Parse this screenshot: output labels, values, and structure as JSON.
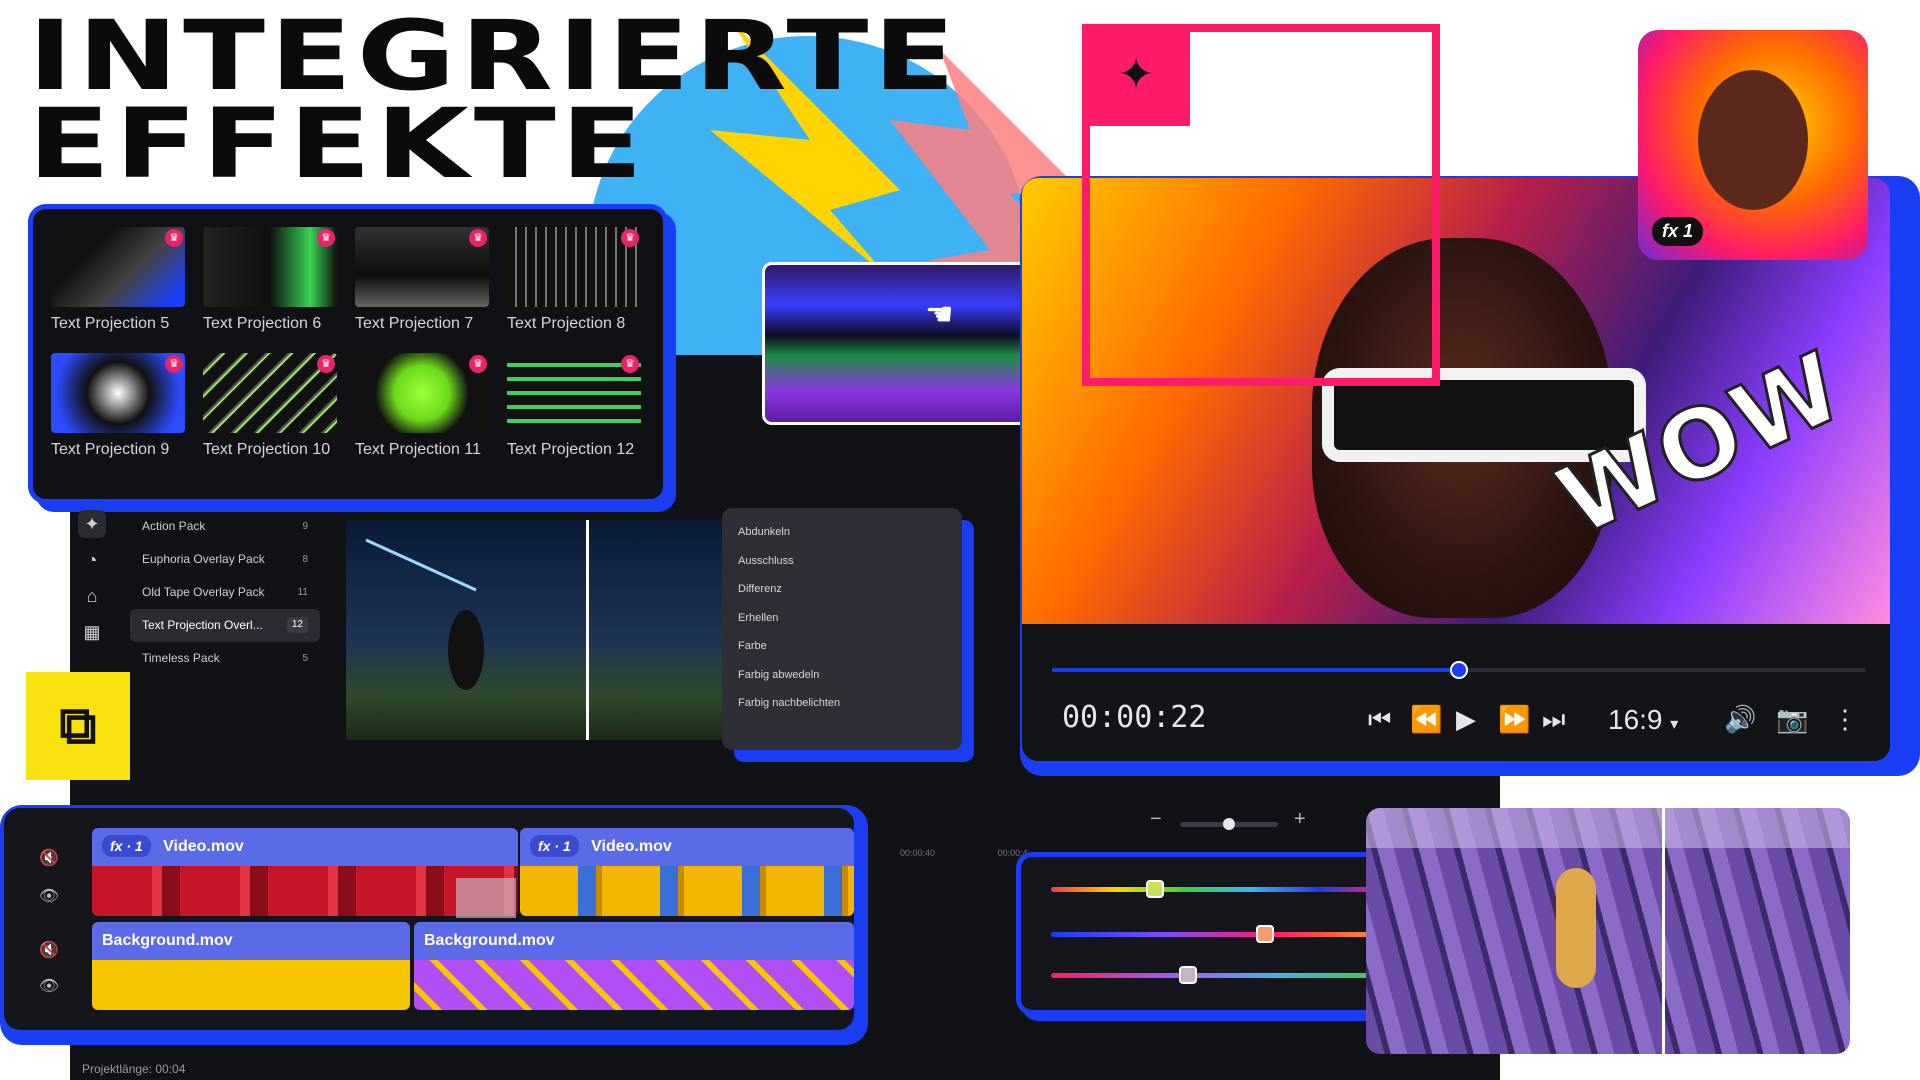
{
  "headline": {
    "line1": "INTEGRIERTE",
    "line2": "EFFEKTE"
  },
  "effects_gallery": {
    "items": [
      {
        "label": "Text Projection 5",
        "premium": true
      },
      {
        "label": "Text Projection 6",
        "premium": true
      },
      {
        "label": "Text Projection 7",
        "premium": true
      },
      {
        "label": "Text Projection 8",
        "premium": true
      },
      {
        "label": "Text Projection 9",
        "premium": true
      },
      {
        "label": "Text Projection 10",
        "premium": true
      },
      {
        "label": "Text Projection 11",
        "premium": true
      },
      {
        "label": "Text Projection 12",
        "premium": true
      }
    ]
  },
  "sidebar": {
    "icons": [
      "effects-icon",
      "stickers-icon",
      "transitions-icon",
      "layout-icon"
    ]
  },
  "packs": [
    {
      "label": "Action Pack",
      "count": "9"
    },
    {
      "label": "Euphoria Overlay Pack",
      "count": "8"
    },
    {
      "label": "Old Tape Overlay Pack",
      "count": "11"
    },
    {
      "label": "Text Projection Overl...",
      "count": "12",
      "selected": true
    },
    {
      "label": "Timeless Pack",
      "count": "5"
    }
  ],
  "blend_modes": [
    "Abdunkeln",
    "Ausschluss",
    "Differenz",
    "Erhellen",
    "Farbe",
    "Farbig abwedeln",
    "Farbig nachbelichten"
  ],
  "player": {
    "timecode": "00:00:22",
    "aspect_ratio": "16:9",
    "progress_fraction": 0.5,
    "wow_text": "WOW",
    "accent": "#1a3ef5"
  },
  "portrait_badge": {
    "fx": "fx",
    "count": "1"
  },
  "timeline": {
    "ruler_labels": [
      "00:00:40",
      "00:00:4"
    ],
    "zoom_fraction": 0.5,
    "tracks": [
      {
        "clips": [
          {
            "name": "Video.mov",
            "fx": "fx",
            "fx_count": "1"
          },
          {
            "name": "Video.mov",
            "fx": "fx",
            "fx_count": "1"
          }
        ]
      },
      {
        "clips": [
          {
            "name": "Background.mov"
          },
          {
            "name": "Background.mov"
          }
        ]
      }
    ]
  },
  "color_sliders": [
    {
      "value": 0.31
    },
    {
      "value": 0.64
    },
    {
      "value": 0.41
    }
  ],
  "status": {
    "project_length": "Projektlänge: 00:04"
  },
  "colors": {
    "accent_blue": "#1a3ef5",
    "pink": "#ff1a6a",
    "yellow": "#f9e110",
    "premium_crown": "#e8246a"
  }
}
